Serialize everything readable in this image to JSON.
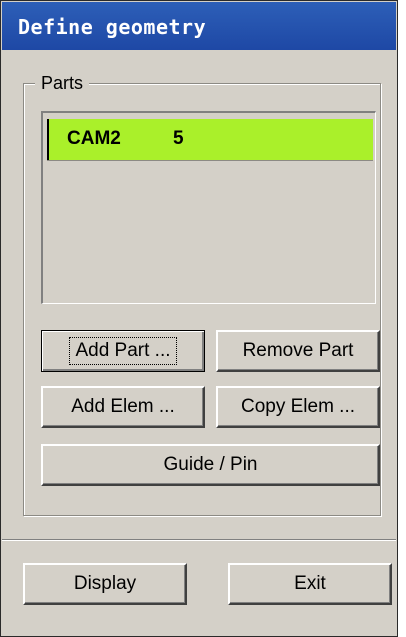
{
  "window": {
    "title": "Define geometry"
  },
  "parts_group": {
    "label": "Parts",
    "list": [
      {
        "name": "CAM2",
        "count": "5",
        "selected": true,
        "highlight_color": "#aaf02a"
      }
    ]
  },
  "buttons": {
    "add_part": "Add Part ...",
    "remove_part": "Remove Part",
    "add_elem": "Add Elem ...",
    "copy_elem": "Copy Elem ...",
    "guide_pin": "Guide / Pin",
    "display": "Display",
    "exit": "Exit"
  },
  "colors": {
    "title_bar": "#1e48a5",
    "dialog_bg": "#d4d0c8",
    "selection": "#aaf02a"
  }
}
